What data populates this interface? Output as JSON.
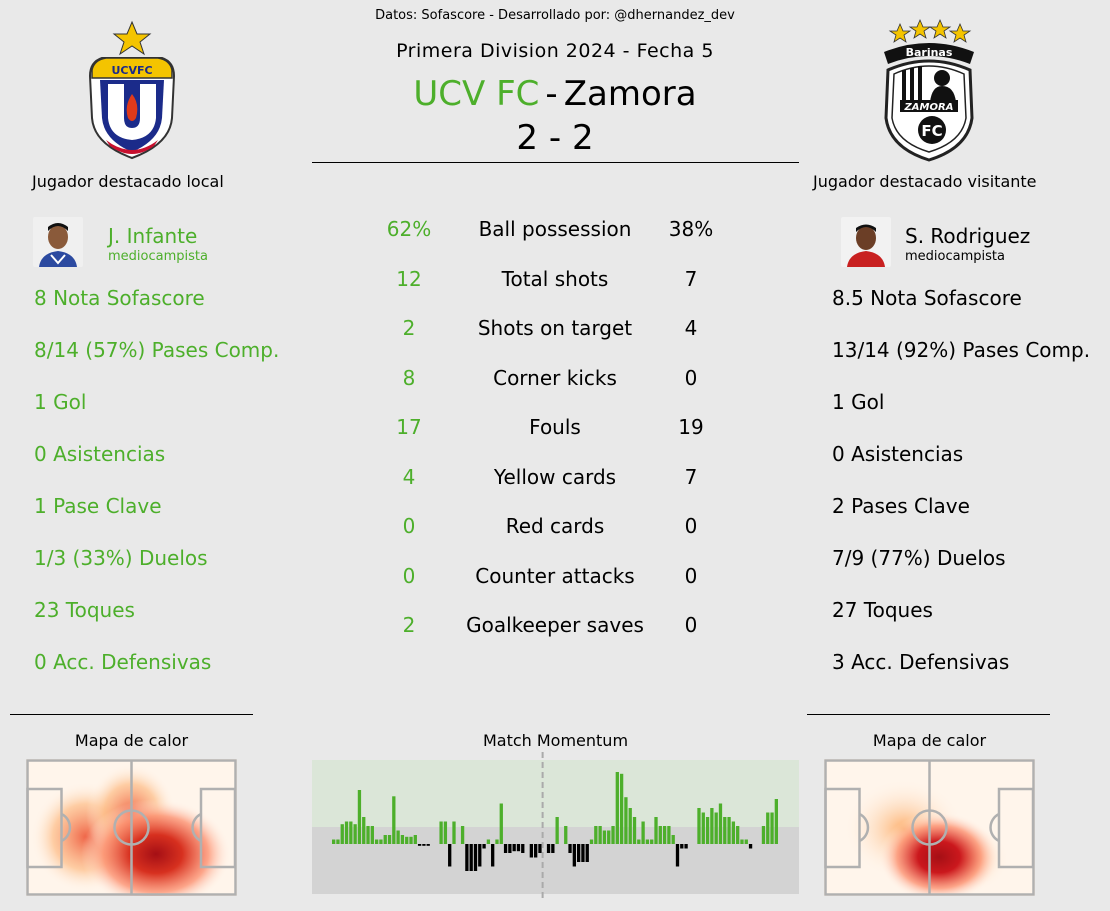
{
  "header": {
    "credits": "Datos: Sofascore - Desarrollado por: @dhernandez_dev",
    "league": "Primera Division 2024 - Fecha 5",
    "home_team": "UCV FC",
    "separator": "-",
    "away_team": "Zamora",
    "score": "2 - 2"
  },
  "home_player": {
    "heading": "Jugador destacado local",
    "name": "J. Infante",
    "position": "mediocampista",
    "stats": [
      "8 Nota Sofascore",
      "8/14 (57%) Pases Comp.",
      "1 Gol",
      "0 Asistencias",
      "1 Pase Clave",
      "1/3 (33%) Duelos",
      "23 Toques",
      "0 Acc. Defensivas"
    ],
    "heatmap_label": "Mapa de calor"
  },
  "away_player": {
    "heading": "Jugador destacado visitante",
    "name": "S. Rodriguez",
    "position": "mediocampista",
    "stats": [
      "8.5 Nota Sofascore",
      "13/14 (92%) Pases Comp.",
      "1 Gol",
      "0 Asistencias",
      "2 Pases Clave",
      "7/9 (77%) Duelos",
      "27 Toques",
      "3 Acc. Defensivas"
    ],
    "heatmap_label": "Mapa de calor"
  },
  "logos": {
    "home_logo_text": "UCVFC",
    "away_logo_top": "Barinas",
    "away_logo_mid": "ZAMORA",
    "away_logo_bottom": "FC"
  },
  "colors": {
    "home": "#4daf2b",
    "away": "#000000",
    "background": "#e9e9e9"
  },
  "match_stats": [
    {
      "name": "Ball possession",
      "home": "62%",
      "away": "38%"
    },
    {
      "name": "Total shots",
      "home": "12",
      "away": "7"
    },
    {
      "name": "Shots on target",
      "home": "2",
      "away": "4"
    },
    {
      "name": "Corner kicks",
      "home": "8",
      "away": "0"
    },
    {
      "name": "Fouls",
      "home": "17",
      "away": "19"
    },
    {
      "name": "Yellow cards",
      "home": "4",
      "away": "7"
    },
    {
      "name": "Red cards",
      "home": "0",
      "away": "0"
    },
    {
      "name": "Counter attacks",
      "home": "0",
      "away": "0"
    },
    {
      "name": "Goalkeeper saves",
      "home": "2",
      "away": "0"
    }
  ],
  "chart_data": {
    "type": "bar",
    "title": "Match Momentum",
    "halftime_index": 49,
    "ylim": [
      -50,
      100
    ],
    "values": [
      5,
      5,
      22,
      25,
      25,
      22,
      60,
      30,
      20,
      20,
      5,
      5,
      10,
      10,
      53,
      15,
      10,
      8,
      8,
      10,
      -2,
      -2,
      -2,
      0,
      0,
      25,
      25,
      -25,
      25,
      0,
      20,
      -30,
      -30,
      -30,
      -25,
      -5,
      5,
      -25,
      5,
      45,
      -10,
      -10,
      -8,
      -8,
      -10,
      0,
      -15,
      -15,
      -10,
      0,
      -10,
      -10,
      30,
      0,
      20,
      -10,
      -25,
      -20,
      -20,
      -20,
      5,
      20,
      20,
      15,
      15,
      20,
      80,
      78,
      52,
      40,
      30,
      5,
      25,
      5,
      5,
      30,
      20,
      20,
      20,
      10,
      -25,
      -5,
      -5,
      0,
      0,
      40,
      35,
      30,
      40,
      35,
      45,
      30,
      30,
      25,
      20,
      5,
      5,
      -5,
      0,
      0,
      20,
      35,
      35,
      50
    ]
  }
}
